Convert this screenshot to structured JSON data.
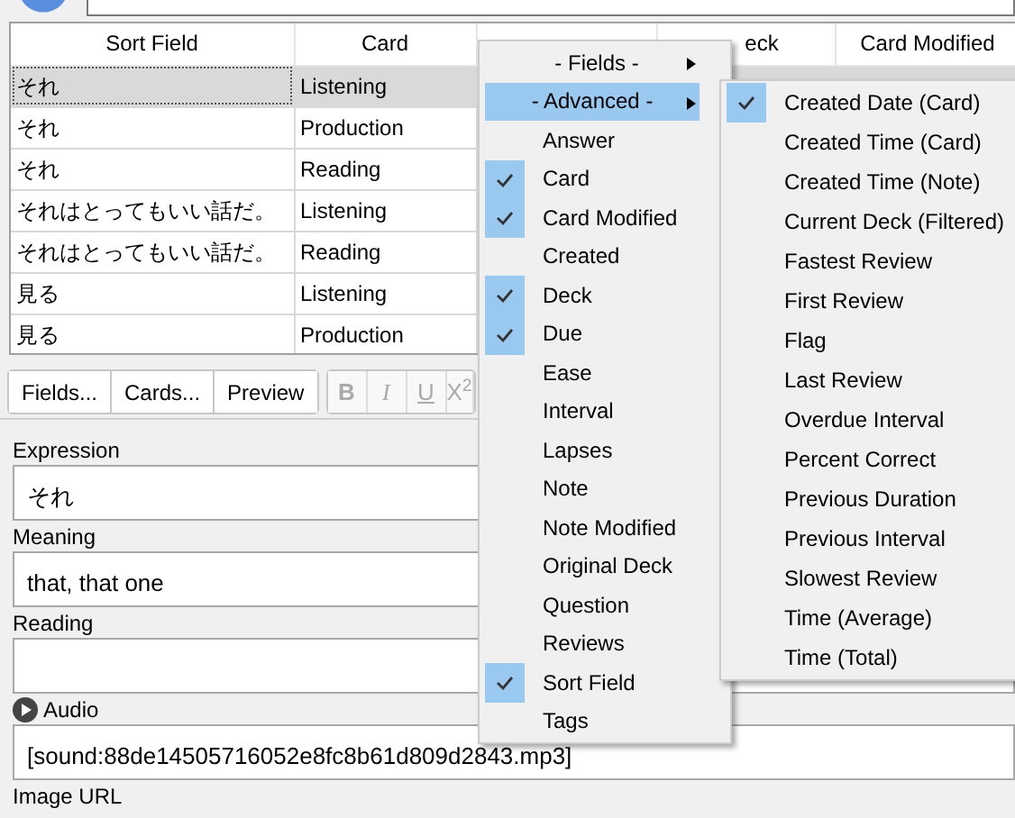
{
  "table": {
    "columns": [
      {
        "label": "Sort Field",
        "kind": "full"
      },
      {
        "label": "Card",
        "kind": "full"
      },
      {
        "kind": "hidden"
      },
      {
        "label": "eck",
        "kind": "cut"
      },
      {
        "label": "Card Modified",
        "kind": "full"
      }
    ],
    "rows": [
      {
        "cells": [
          "それ",
          "Listening"
        ],
        "selected": true
      },
      {
        "cells": [
          "それ",
          "Production"
        ],
        "selected": false
      },
      {
        "cells": [
          "それ",
          "Reading"
        ],
        "selected": false
      },
      {
        "cells": [
          "それはとってもいい話だ。",
          "Listening"
        ],
        "selected": false
      },
      {
        "cells": [
          "それはとってもいい話だ。",
          "Reading"
        ],
        "selected": false
      },
      {
        "cells": [
          "見る",
          "Listening"
        ],
        "selected": false
      },
      {
        "cells": [
          "見る",
          "Production"
        ],
        "selected": false
      }
    ]
  },
  "toolbar": {
    "buttons": [
      "Fields...",
      "Cards...",
      "Preview"
    ],
    "format_buttons": [
      {
        "label": "B",
        "kind": "bold",
        "disabled": true
      },
      {
        "label": "I",
        "kind": "italic",
        "disabled": true
      },
      {
        "label": "U",
        "kind": "underline",
        "disabled": true
      },
      {
        "label": "X$^{2}$",
        "kind": "plain",
        "disabled": true
      }
    ]
  },
  "fields": [
    {
      "label": "Expression",
      "value": "それ",
      "kind": "text"
    },
    {
      "label": "Meaning",
      "value": "that, that one",
      "kind": "text"
    },
    {
      "label": "Reading",
      "kind": "text"
    },
    {
      "label": "Audio",
      "value": "[sound:88de14505716052e8fc8b61d809d2843.mp3]",
      "kind": "audio"
    },
    {
      "label": "Image URL",
      "kind": "cut"
    }
  ],
  "columns_menu": {
    "items": [
      {
        "label": "- Fields -",
        "kind": "submenu",
        "selected": false
      },
      {
        "label": "- Advanced -",
        "kind": "submenu",
        "selected": true
      },
      {
        "label": "Answer",
        "kind": "option",
        "checked": false
      },
      {
        "label": "Card",
        "kind": "option",
        "checked": true
      },
      {
        "label": "Card Modified",
        "kind": "option",
        "checked": true
      },
      {
        "label": "Created",
        "kind": "option",
        "checked": false
      },
      {
        "label": "Deck",
        "kind": "option",
        "checked": true
      },
      {
        "label": "Due",
        "kind": "option",
        "checked": true
      },
      {
        "label": "Ease",
        "kind": "option",
        "checked": false
      },
      {
        "label": "Interval",
        "kind": "option",
        "checked": false
      },
      {
        "label": "Lapses",
        "kind": "option",
        "checked": false
      },
      {
        "label": "Note",
        "kind": "option",
        "checked": false
      },
      {
        "label": "Note Modified",
        "kind": "option",
        "checked": false
      },
      {
        "label": "Original Deck",
        "kind": "option",
        "checked": false
      },
      {
        "label": "Question",
        "kind": "option",
        "checked": false
      },
      {
        "label": "Reviews",
        "kind": "option",
        "checked": false
      },
      {
        "label": "Sort Field",
        "kind": "option",
        "checked": true
      },
      {
        "label": "Tags",
        "kind": "option",
        "checked": false
      }
    ],
    "submenu": [
      {
        "label": "Created Date (Card)",
        "checked": true
      },
      {
        "label": "Created Time (Card)",
        "checked": false
      },
      {
        "label": "Created Time (Note)",
        "checked": false
      },
      {
        "label": "Current Deck (Filtered)",
        "checked": false
      },
      {
        "label": "Fastest Review",
        "checked": false
      },
      {
        "label": "First Review",
        "checked": false
      },
      {
        "label": "Flag",
        "checked": false
      },
      {
        "label": "Last Review",
        "checked": false
      },
      {
        "label": "Overdue Interval",
        "checked": false
      },
      {
        "label": "Percent Correct",
        "checked": false
      },
      {
        "label": "Previous Duration",
        "checked": false
      },
      {
        "label": "Previous Interval",
        "checked": false
      },
      {
        "label": "Slowest Review",
        "checked": false
      },
      {
        "label": "Time (Average)",
        "checked": false
      },
      {
        "label": "Time (Total)",
        "checked": false
      }
    ]
  }
}
